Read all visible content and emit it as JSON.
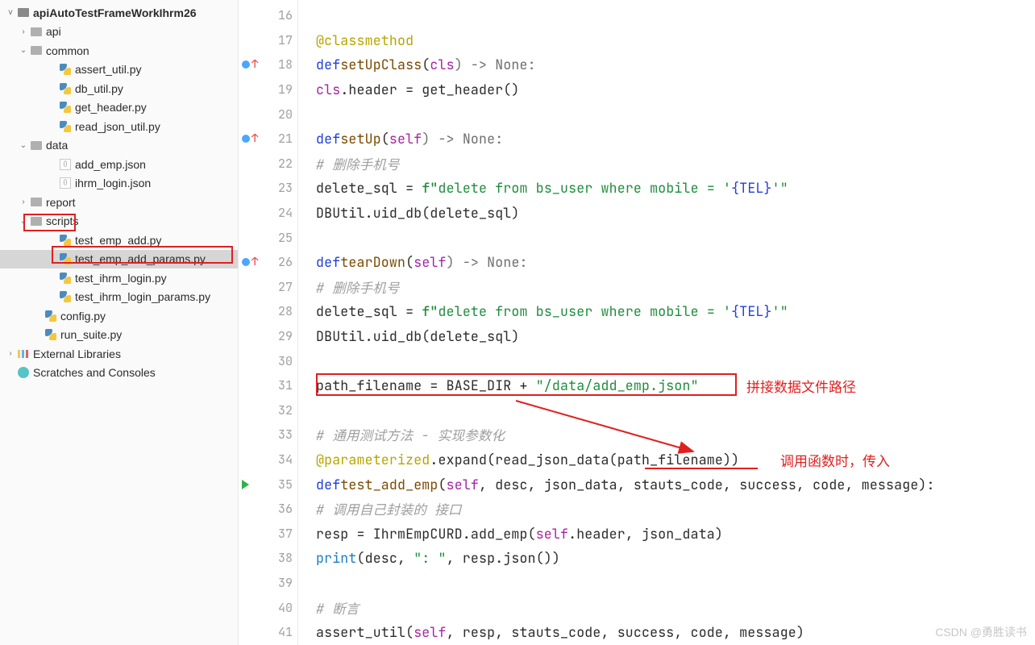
{
  "sidebar": {
    "root": "apiAutoTestFrameWorkIhrm26",
    "items": [
      {
        "indent": 22,
        "expander": ">",
        "type": "folder",
        "label": "api"
      },
      {
        "indent": 22,
        "expander": "v",
        "type": "folder",
        "label": "common"
      },
      {
        "indent": 58,
        "expander": "",
        "type": "py",
        "label": "assert_util.py"
      },
      {
        "indent": 58,
        "expander": "",
        "type": "py",
        "label": "db_util.py"
      },
      {
        "indent": 58,
        "expander": "",
        "type": "py",
        "label": "get_header.py"
      },
      {
        "indent": 58,
        "expander": "",
        "type": "py",
        "label": "read_json_util.py"
      },
      {
        "indent": 22,
        "expander": "v",
        "type": "folder",
        "label": "data"
      },
      {
        "indent": 58,
        "expander": "",
        "type": "json",
        "label": "add_emp.json"
      },
      {
        "indent": 58,
        "expander": "",
        "type": "json",
        "label": "ihrm_login.json"
      },
      {
        "indent": 22,
        "expander": ">",
        "type": "folder",
        "label": "report"
      },
      {
        "indent": 22,
        "expander": "v",
        "type": "folder",
        "label": "scripts"
      },
      {
        "indent": 58,
        "expander": "",
        "type": "py",
        "label": "test_emp_add.py"
      },
      {
        "indent": 58,
        "expander": "",
        "type": "py",
        "label": "test_emp_add_params.py",
        "selected": true
      },
      {
        "indent": 58,
        "expander": "",
        "type": "py",
        "label": "test_ihrm_login.py"
      },
      {
        "indent": 58,
        "expander": "",
        "type": "py",
        "label": "test_ihrm_login_params.py"
      },
      {
        "indent": 40,
        "expander": "",
        "type": "py",
        "label": "config.py"
      },
      {
        "indent": 40,
        "expander": "",
        "type": "py",
        "label": "run_suite.py"
      },
      {
        "indent": 6,
        "expander": ">",
        "type": "lib",
        "label": "External Libraries"
      },
      {
        "indent": 6,
        "expander": "",
        "type": "scratch",
        "label": "Scratches and Consoles"
      }
    ]
  },
  "gutter": {
    "lines": [
      {
        "n": 16
      },
      {
        "n": 17
      },
      {
        "n": 18,
        "blue": true,
        "up": true
      },
      {
        "n": 19
      },
      {
        "n": 20
      },
      {
        "n": 21,
        "blue": true,
        "up": true
      },
      {
        "n": 22
      },
      {
        "n": 23
      },
      {
        "n": 24
      },
      {
        "n": 25
      },
      {
        "n": 26,
        "blue": true,
        "up": true
      },
      {
        "n": 27
      },
      {
        "n": 28
      },
      {
        "n": 29
      },
      {
        "n": 30
      },
      {
        "n": 31
      },
      {
        "n": 32
      },
      {
        "n": 33
      },
      {
        "n": 34
      },
      {
        "n": 35,
        "play": true
      },
      {
        "n": 36
      },
      {
        "n": 37
      },
      {
        "n": 38
      },
      {
        "n": 39
      },
      {
        "n": 40
      },
      {
        "n": 41
      }
    ]
  },
  "code": {
    "l17_decorator": "@classmethod",
    "l18_def": "def",
    "l18_name": "setUpClass",
    "l18_param": "cls",
    "l18_tail": ") -> None:",
    "l19_a": "cls",
    "l19_b": ".header = get_header()",
    "l21_def": "def",
    "l21_name": "setUp",
    "l21_param": "self",
    "l21_tail": ") -> None:",
    "l22_comment": "# 删除手机号",
    "l23_a": "delete_sql = ",
    "l23_prefix": "f\"",
    "l23_body": "delete from bs_user where mobile = '",
    "l23_interp": "{TEL}",
    "l23_suffix": "'\"",
    "l24": "DBUtil.uid_db(delete_sql)",
    "l26_def": "def",
    "l26_name": "tearDown",
    "l26_param": "self",
    "l26_tail": ") -> None:",
    "l27_comment": "# 删除手机号",
    "l28_a": "delete_sql = ",
    "l28_prefix": "f\"",
    "l28_body": "delete from bs_user where mobile = '",
    "l28_interp": "{TEL}",
    "l28_suffix": "'\"",
    "l29": "DBUtil.uid_db(delete_sql)",
    "l31_a": "path_filename = BASE_DIR + ",
    "l31_str": "\"/data/add_emp.json\"",
    "l33_comment": "# 通用测试方法 - 实现参数化",
    "l34_dec": "@parameterized",
    "l34_tail": ".expand(read_json_data(path_filename))",
    "l35_def": "def",
    "l35_name": "test_add_emp",
    "l35_param": "self",
    "l35_tail": ", desc, json_data, stauts_code, success, code, message):",
    "l36_comment": "# 调用自己封装的 接口",
    "l37_a": "resp = IhrmEmpCURD.add_emp(",
    "l37_self": "self",
    "l37_b": ".header, json_data)",
    "l38_print": "print",
    "l38_a": "(desc, ",
    "l38_str": "\": \"",
    "l38_b": ", resp.json())",
    "l40_comment": "# 断言",
    "l41_a": "assert_util(",
    "l41_self": "self",
    "l41_b": ", resp, stauts_code, success, code, message)"
  },
  "annotations": {
    "anno1": "拼接数据文件路径",
    "anno2": "调用函数时，传入",
    "watermark": "CSDN @勇胜读书"
  }
}
